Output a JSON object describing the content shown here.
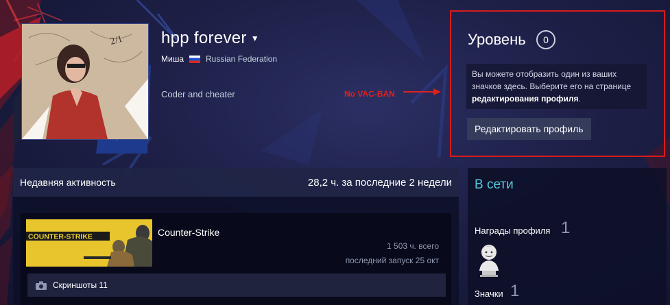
{
  "profile": {
    "persona_name": "hpp forever",
    "real_name": "Миша",
    "country": "Russian Federation",
    "summary": "Coder and cheater",
    "annotation": "No VAC-BAN"
  },
  "level": {
    "title": "Уровень",
    "value": "0",
    "info_text": "Вы можете отобразить один из ваших значков здесь. Выберите его на странице ",
    "info_link": "редактирования профиля",
    "info_end": ".",
    "edit_button": "Редактировать профиль"
  },
  "activity": {
    "title": "Недавняя активность",
    "hours": "28,2 ч. за последние 2 недели",
    "games": [
      {
        "name": "Counter-Strike",
        "capsule_text": "COUNTER-STRIKE",
        "total_hours": "1 503 ч. всего",
        "last_played": "последний запуск 25 окт",
        "screenshots": "Скриншоты 11"
      }
    ]
  },
  "sidebar": {
    "status": "В сети",
    "awards_label": "Награды профиля",
    "awards_count": "1",
    "badges_label": "Значки",
    "badges_count": "1"
  },
  "colors": {
    "accent_online": "#57cbde",
    "annotation_red": "#d81b1b",
    "background": "#1d1f46"
  }
}
